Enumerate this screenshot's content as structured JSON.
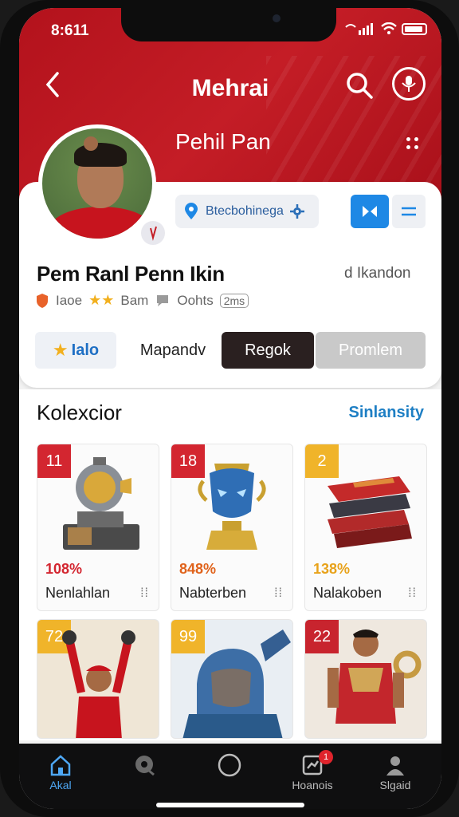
{
  "status": {
    "time": "8:611"
  },
  "header": {
    "title": "Mehrai",
    "profile_name": "Pehil Pan"
  },
  "profile": {
    "chip_text": "Btecbohinega",
    "name": "Pem Ranl Penn Ikin",
    "subtitle": "d Ikandon",
    "meta": {
      "item1": "Iaoe",
      "item2": "Bam",
      "item3": "Oohts",
      "badge": "2ms"
    }
  },
  "tabs": [
    {
      "label": "Ialo"
    },
    {
      "label": "Mapandv"
    },
    {
      "label": "Regok"
    },
    {
      "label": "Promlem"
    }
  ],
  "collection": {
    "title": "Kolexcior",
    "link": "Sinlansity",
    "items": [
      {
        "badge": "11",
        "pct": "108%",
        "label": "Nenlahlan",
        "badge_color": "#d32630",
        "pct_color": "#d32630"
      },
      {
        "badge": "18",
        "pct": "848%",
        "label": "Nabterben",
        "badge_color": "#d32630",
        "pct_color": "#e0631c"
      },
      {
        "badge": "2",
        "pct": "138%",
        "label": "Nalakoben",
        "badge_color": "#f0b42a",
        "pct_color": "#e8a21a"
      },
      {
        "badge": "72",
        "pct": "",
        "label": "",
        "badge_color": "#f0b42a",
        "pct_color": "#000000"
      },
      {
        "badge": "99",
        "pct": "",
        "label": "",
        "badge_color": "#f0b42a",
        "pct_color": "#000000"
      },
      {
        "badge": "22",
        "pct": "",
        "label": "",
        "badge_color": "#c8242e",
        "pct_color": "#000000"
      }
    ]
  },
  "tabbar": [
    {
      "label": "Akal",
      "icon": "home-icon"
    },
    {
      "label": "",
      "icon": "chat-icon"
    },
    {
      "label": "",
      "icon": "circle-icon"
    },
    {
      "label": "Hoanois",
      "icon": "notifications-icon",
      "badge": "1"
    },
    {
      "label": "Slgaid",
      "icon": "profile-icon"
    }
  ]
}
